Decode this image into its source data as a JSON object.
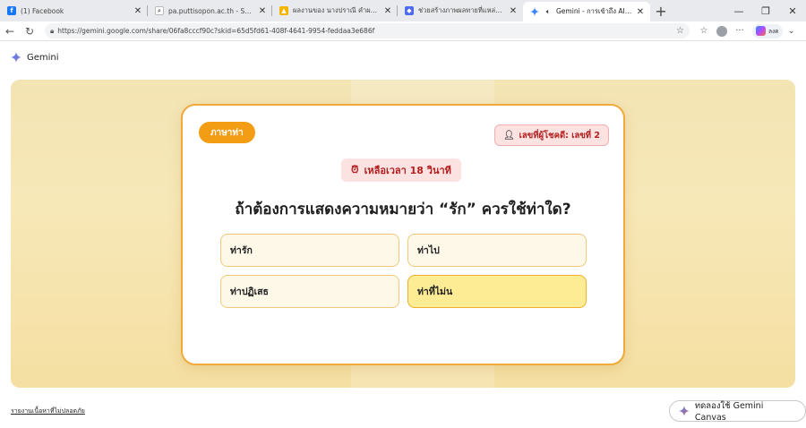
{
  "browser": {
    "tabs": [
      {
        "title": "(1) Facebook",
        "icon": "facebook-icon",
        "color": "#1877f2",
        "active": false
      },
      {
        "title": "pa.puttisopon.ac.th - Search",
        "icon": "search-icon",
        "color": "#9aa0a6",
        "active": false
      },
      {
        "title": "ผลงานของ นางปราณี คำผง - โรงเรียนฯ",
        "icon": "drive-icon",
        "color": "#f4b400",
        "active": false
      },
      {
        "title": "ช่วยสร้างภาพผลทายที่แหล่งที่มีความในบ้าน",
        "icon": "app-icon",
        "color": "#4f6bed",
        "active": false
      },
      {
        "title": "Gemini - การเข้าถึง AI ของ Goo",
        "icon": "gemini-icon",
        "color": "#4285f4",
        "active": true
      }
    ],
    "url": "https://gemini.google.com/share/06fa8cccf90c?skid=65d5fd61-408f-4641-9954-feddaa3e686f",
    "copilot_label": "ลงค"
  },
  "gemini": {
    "app_name": "Gemini",
    "report_link": "รายงานเนื้อหาที่ไม่ปลอดภัย",
    "try_canvas_label": "ทดลองใช้ Gemini Canvas"
  },
  "game": {
    "language_pill": "ภาษาท่า",
    "player_badge": "เลขที่ผู้โชคดี: เลขที่ 2",
    "timer": "เหลือเวลา 18 วินาที",
    "question": "ถ้าต้องการแสดงความหมายว่า “รัก” ควรใช้ท่าใด?",
    "options": [
      {
        "label": "ท่ารัก",
        "selected": false
      },
      {
        "label": "ท่าไป",
        "selected": false
      },
      {
        "label": "ท่าปฏิเสธ",
        "selected": false
      },
      {
        "label": "ท่าที่ไม่น",
        "selected": true
      }
    ]
  },
  "colors": {
    "accent": "#f29d14",
    "card_border": "#f0a93a",
    "badge_bg": "#fde2e2",
    "badge_text": "#b21f1f",
    "selected_option": "#fdec94"
  }
}
